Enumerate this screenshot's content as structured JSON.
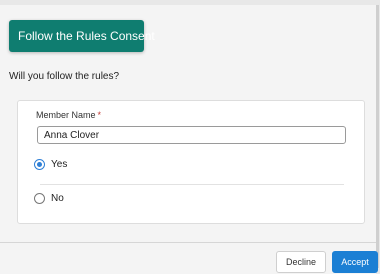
{
  "dialog": {
    "title": "Follow the Rules Consent",
    "question": "Will you follow the rules?"
  },
  "form": {
    "member_name": {
      "label": "Member Name",
      "required_marker": "*",
      "value": "Anna Clover"
    },
    "options": [
      {
        "label": "Yes",
        "selected": true
      },
      {
        "label": "No",
        "selected": false
      }
    ]
  },
  "footer": {
    "decline_label": "Decline",
    "accept_label": "Accept"
  },
  "colors": {
    "banner": "#0f7d70",
    "accent": "#1b7fd4",
    "required": "#c23934"
  }
}
